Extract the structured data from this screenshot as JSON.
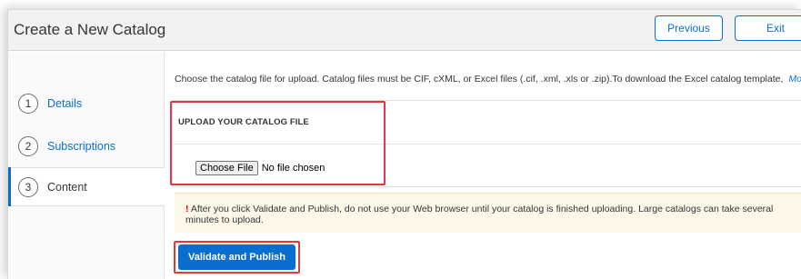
{
  "header": {
    "title": "Create a New Catalog",
    "previous_label": "Previous",
    "exit_label": "Exit"
  },
  "steps": [
    {
      "number": "1",
      "label": "Details",
      "state": "link"
    },
    {
      "number": "2",
      "label": "Subscriptions",
      "state": "link"
    },
    {
      "number": "3",
      "label": "Content",
      "state": "active"
    }
  ],
  "content": {
    "intro_text": "Choose the catalog file for upload. Catalog files must be CIF, cXML, or Excel files (.cif, .xml, .xls or .zip).To download the Excel catalog template,",
    "intro_more": "Mor",
    "upload_heading": "UPLOAD YOUR CATALOG FILE",
    "choose_file_label": "Choose File",
    "no_file_text": "No file chosen",
    "warning_mark": "!",
    "warning_text": "After you click Validate and Publish, do not use your Web browser until your catalog is finished uploading. Large catalogs can take several minutes to upload.",
    "validate_label": "Validate and Publish"
  },
  "colors": {
    "accent": "#0a6ed1",
    "highlight": "#e03a40",
    "warning_bg": "#fdf7e8",
    "warning_mark": "#ee0000"
  }
}
